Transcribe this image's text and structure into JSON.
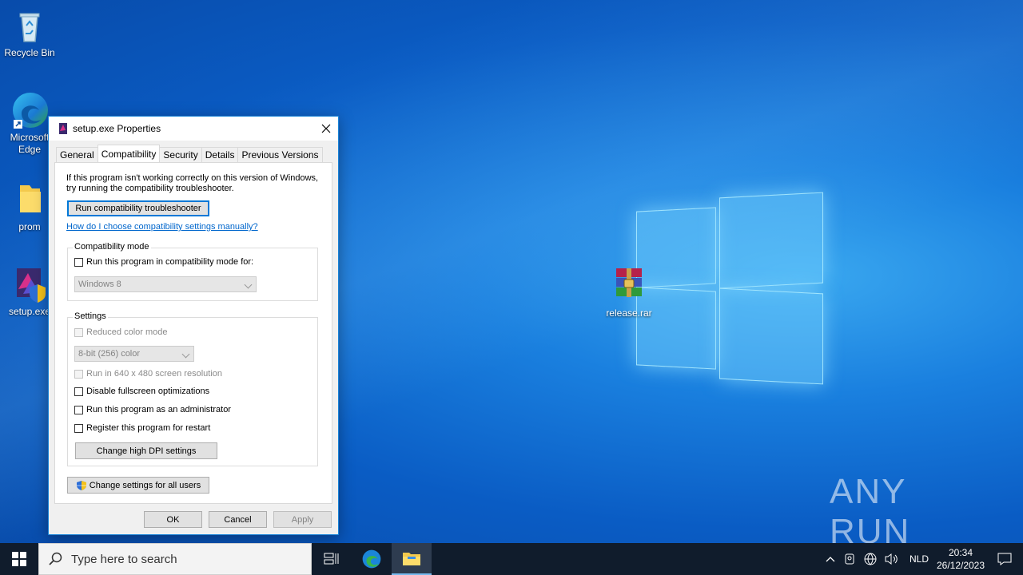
{
  "desktop": {
    "icons": [
      {
        "label": "Recycle Bin"
      },
      {
        "label": "Microsoft Edge"
      },
      {
        "label": "prom"
      },
      {
        "label": "setup.exe"
      },
      {
        "label": "release.rar"
      }
    ],
    "watermark": "ANY RUN"
  },
  "dialog": {
    "title": "setup.exe Properties",
    "tabs": [
      "General",
      "Compatibility",
      "Security",
      "Details",
      "Previous Versions"
    ],
    "active_tab": "Compatibility",
    "intro_line1": "If this program isn't working correctly on this version of Windows,",
    "intro_line2": "try running the compatibility troubleshooter.",
    "troubleshooter_button": "Run compatibility troubleshooter",
    "help_link": "How do I choose compatibility settings manually?",
    "compat_mode": {
      "group_title": "Compatibility mode",
      "checkbox_label": "Run this program in compatibility mode for:",
      "os_selected": "Windows 8"
    },
    "settings": {
      "group_title": "Settings",
      "reduced_color_label": "Reduced color mode",
      "color_selected": "8-bit (256) color",
      "res_640_label": "Run in 640 x 480 screen resolution",
      "disable_fullscreen_label": "Disable fullscreen optimizations",
      "run_admin_label": "Run this program as an administrator",
      "register_restart_label": "Register this program for restart",
      "high_dpi_button": "Change high DPI settings"
    },
    "all_users_button": "Change settings for all users",
    "ok": "OK",
    "cancel": "Cancel",
    "apply": "Apply"
  },
  "taskbar": {
    "search_placeholder": "Type here to search",
    "language": "NLD",
    "time": "20:34",
    "date": "26/12/2023"
  },
  "colors": {
    "accent": "#0078d7",
    "taskbar": "#101c2c",
    "link": "#0066cc"
  }
}
